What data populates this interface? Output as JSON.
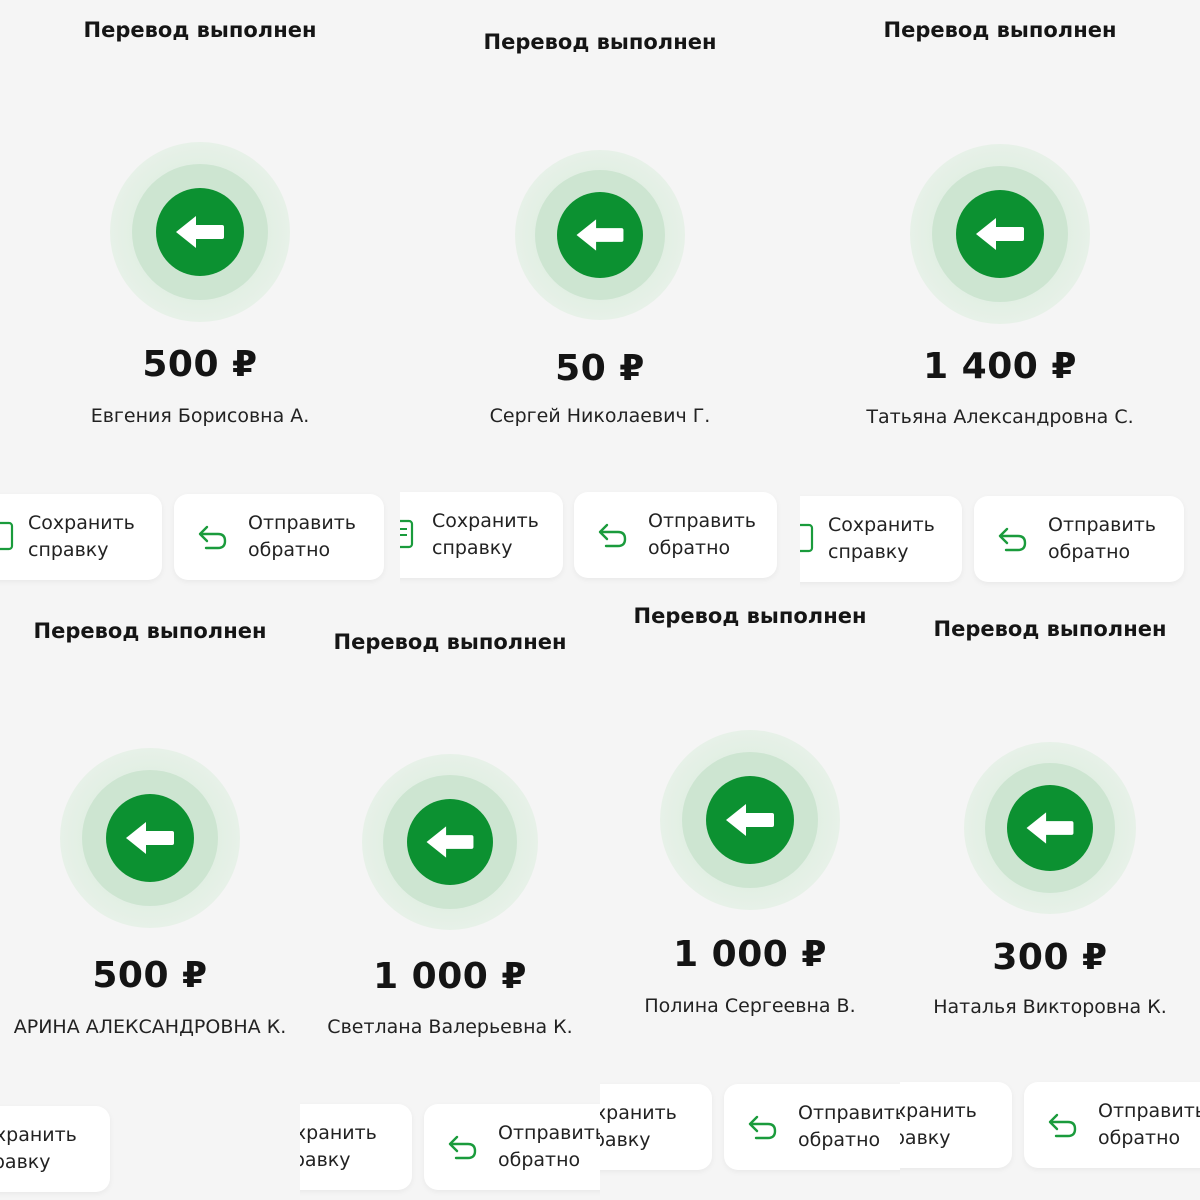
{
  "colors": {
    "accent_green": "#0c9131",
    "ring_light": "#e7f1e8",
    "ring_mid": "#cde5d1",
    "background": "#f5f5f5",
    "button_bg": "#ffffff"
  },
  "icons": {
    "transfer": "arrow-left-icon",
    "save": "document-icon",
    "send_back": "return-arrow-icon"
  },
  "screens": [
    {
      "title": "Перевод выполнен",
      "amount": "500 ₽",
      "recipient": "Евгения Борисовна А.",
      "save_label": "Сохранить\nсправку",
      "send_back_label": "Отправить\nобратно"
    },
    {
      "title": "Перевод выполнен",
      "amount": "50 ₽",
      "recipient": "Сергей Николаевич Г.",
      "save_label": "Сохранить\nсправку",
      "send_back_label": "Отправить\nобратно"
    },
    {
      "title": "Перевод выполнен",
      "amount": "1 400 ₽",
      "recipient": "Татьяна Александровна С.",
      "save_label": "Сохранить\nсправку",
      "send_back_label": "Отправить\nобратно"
    },
    {
      "title": "Перевод выполнен",
      "amount": "500 ₽",
      "recipient": "АРИНА АЛЕКСАНДРОВНА К.",
      "save_label": "Сохранить\nсправку"
    },
    {
      "title": "Перевод выполнен",
      "amount": "1 000 ₽",
      "recipient": "Светлана Валерьевна К.",
      "save_label": "Сохранить\nсправку",
      "send_back_label": "Отправить\nобратно"
    },
    {
      "title": "Перевод выполнен",
      "amount": "1 000 ₽",
      "recipient": "Полина Сергеевна В.",
      "save_label": "Сохранить\nсправку",
      "send_back_label": "Отправить\nобратно"
    },
    {
      "title": "Перевод выполнен",
      "amount": "300 ₽",
      "recipient": "Наталья Викторовна К.",
      "save_label": "Сохранить\nсправку",
      "send_back_label": "Отправить\nобратно"
    }
  ]
}
